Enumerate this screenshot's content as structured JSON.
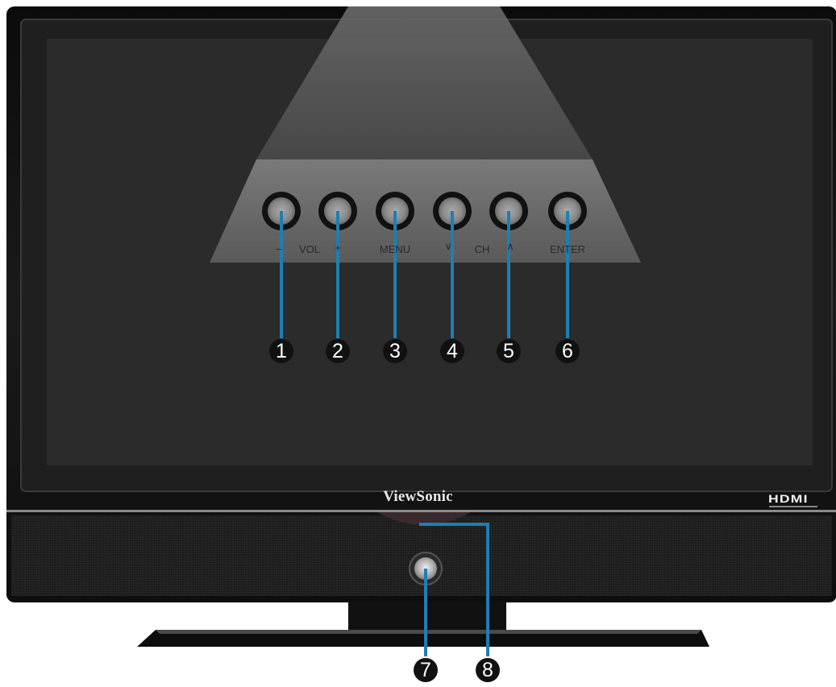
{
  "brand": "ViewSonic",
  "hdmi_logo": "HDMI",
  "button_labels": {
    "vol_minus": "−",
    "vol": "VOL",
    "vol_plus": "+",
    "menu": "MENU",
    "ch_down": "∨",
    "ch": "CH",
    "ch_up": "∧",
    "enter": "ENTER"
  },
  "callouts": [
    "1",
    "2",
    "3",
    "4",
    "5",
    "6",
    "7",
    "8"
  ],
  "colors": {
    "callout_line": "#1c7fb5",
    "bezel": "#161616",
    "screen": "#2b2b2b",
    "callout_badge": "#111111"
  }
}
